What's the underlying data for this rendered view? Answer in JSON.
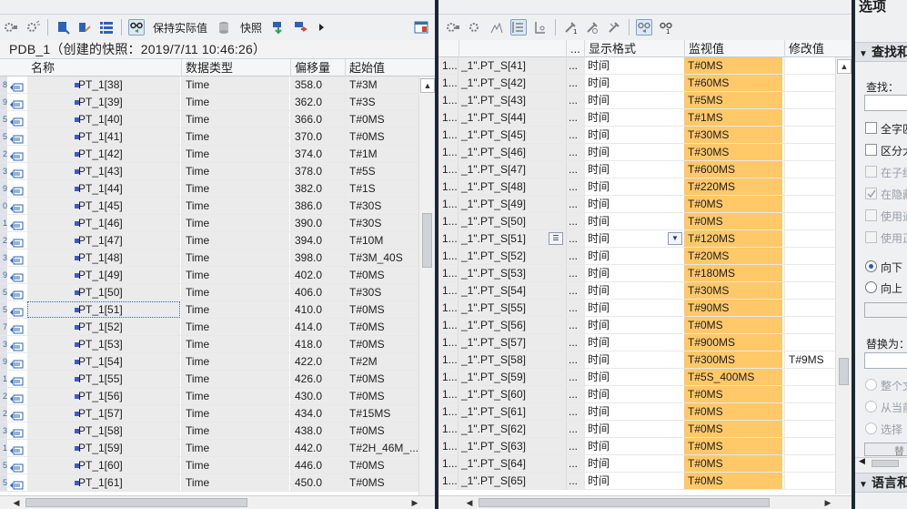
{
  "left_pane": {
    "toolbar": {
      "keep_actual_label": "保持实际值",
      "snapshot_label": "快照"
    },
    "snapshot_title": "PDB_1（创建的快照：2019/7/11 10:46:26）",
    "columns": {
      "name": "名称",
      "datatype": "数据类型",
      "offset": "偏移量",
      "start": "起始值"
    },
    "rows": [
      {
        "num": "8",
        "name": "PT_1[38]",
        "type": "Time",
        "offset": "358.0",
        "start": "T#3M"
      },
      {
        "num": "9",
        "name": "PT_1[39]",
        "type": "Time",
        "offset": "362.0",
        "start": "T#3S"
      },
      {
        "num": "5",
        "name": "PT_1[40]",
        "type": "Time",
        "offset": "366.0",
        "start": "T#0MS"
      },
      {
        "num": "5",
        "name": "PT_1[41]",
        "type": "Time",
        "offset": "370.0",
        "start": "T#0MS"
      },
      {
        "num": "2",
        "name": "PT_1[42]",
        "type": "Time",
        "offset": "374.0",
        "start": "T#1M"
      },
      {
        "num": "3",
        "name": "PT_1[43]",
        "type": "Time",
        "offset": "378.0",
        "start": "T#5S"
      },
      {
        "num": "9",
        "name": "PT_1[44]",
        "type": "Time",
        "offset": "382.0",
        "start": "T#1S"
      },
      {
        "num": "0",
        "name": "PT_1[45]",
        "type": "Time",
        "offset": "386.0",
        "start": "T#30S"
      },
      {
        "num": "1",
        "name": "PT_1[46]",
        "type": "Time",
        "offset": "390.0",
        "start": "T#30S"
      },
      {
        "num": "2",
        "name": "PT_1[47]",
        "type": "Time",
        "offset": "394.0",
        "start": "T#10M"
      },
      {
        "num": "3",
        "name": "PT_1[48]",
        "type": "Time",
        "offset": "398.0",
        "start": "T#3M_40S"
      },
      {
        "num": "9",
        "name": "PT_1[49]",
        "type": "Time",
        "offset": "402.0",
        "start": "T#0MS"
      },
      {
        "num": "5",
        "name": "PT_1[50]",
        "type": "Time",
        "offset": "406.0",
        "start": "T#30S"
      },
      {
        "num": "5",
        "name": "PT_1[51]",
        "type": "Time",
        "offset": "410.0",
        "start": "T#0MS"
      },
      {
        "num": "7",
        "name": "PT_1[52]",
        "type": "Time",
        "offset": "414.0",
        "start": "T#0MS"
      },
      {
        "num": "3",
        "name": "PT_1[53]",
        "type": "Time",
        "offset": "418.0",
        "start": "T#0MS"
      },
      {
        "num": "9",
        "name": "PT_1[54]",
        "type": "Time",
        "offset": "422.0",
        "start": "T#2M"
      },
      {
        "num": "1",
        "name": "PT_1[55]",
        "type": "Time",
        "offset": "426.0",
        "start": "T#0MS"
      },
      {
        "num": "2",
        "name": "PT_1[56]",
        "type": "Time",
        "offset": "430.0",
        "start": "T#0MS"
      },
      {
        "num": "2",
        "name": "PT_1[57]",
        "type": "Time",
        "offset": "434.0",
        "start": "T#15MS"
      },
      {
        "num": "3",
        "name": "PT_1[58]",
        "type": "Time",
        "offset": "438.0",
        "start": "T#0MS"
      },
      {
        "num": "1",
        "name": "PT_1[59]",
        "type": "Time",
        "offset": "442.0",
        "start": "T#2H_46M_..."
      },
      {
        "num": "5",
        "name": "PT_1[60]",
        "type": "Time",
        "offset": "446.0",
        "start": "T#0MS"
      },
      {
        "num": "5",
        "name": "PT_1[61]",
        "type": "Time",
        "offset": "450.0",
        "start": "T#0MS"
      }
    ]
  },
  "mid_pane": {
    "columns": {
      "dots": "...",
      "format": "显示格式",
      "monitor": "监视值",
      "modify": "修改值"
    },
    "rows": [
      {
        "idx": "1...",
        "name": "_1\".PT_S[41]",
        "dots": "...",
        "format": "时间",
        "monitor": "T#0MS",
        "modify": ""
      },
      {
        "idx": "1...",
        "name": "_1\".PT_S[42]",
        "dots": "...",
        "format": "时间",
        "monitor": "T#60MS",
        "modify": ""
      },
      {
        "idx": "1...",
        "name": "_1\".PT_S[43]",
        "dots": "...",
        "format": "时间",
        "monitor": "T#5MS",
        "modify": ""
      },
      {
        "idx": "1...",
        "name": "_1\".PT_S[44]",
        "dots": "...",
        "format": "时间",
        "monitor": "T#1MS",
        "modify": ""
      },
      {
        "idx": "1...",
        "name": "_1\".PT_S[45]",
        "dots": "...",
        "format": "时间",
        "monitor": "T#30MS",
        "modify": ""
      },
      {
        "idx": "1...",
        "name": "_1\".PT_S[46]",
        "dots": "...",
        "format": "时间",
        "monitor": "T#30MS",
        "modify": ""
      },
      {
        "idx": "1...",
        "name": "_1\".PT_S[47]",
        "dots": "...",
        "format": "时间",
        "monitor": "T#600MS",
        "modify": ""
      },
      {
        "idx": "1...",
        "name": "_1\".PT_S[48]",
        "dots": "...",
        "format": "时间",
        "monitor": "T#220MS",
        "modify": ""
      },
      {
        "idx": "1...",
        "name": "_1\".PT_S[49]",
        "dots": "...",
        "format": "时间",
        "monitor": "T#0MS",
        "modify": ""
      },
      {
        "idx": "1...",
        "name": "_1\".PT_S[50]",
        "dots": "...",
        "format": "时间",
        "monitor": "T#0MS",
        "modify": ""
      },
      {
        "idx": "1...",
        "name": "_1\".PT_S[51]",
        "dots": "...",
        "format": "时间",
        "monitor": "T#120MS",
        "modify": ""
      },
      {
        "idx": "1...",
        "name": "_1\".PT_S[52]",
        "dots": "...",
        "format": "时间",
        "monitor": "T#20MS",
        "modify": ""
      },
      {
        "idx": "1...",
        "name": "_1\".PT_S[53]",
        "dots": "...",
        "format": "时间",
        "monitor": "T#180MS",
        "modify": ""
      },
      {
        "idx": "1...",
        "name": "_1\".PT_S[54]",
        "dots": "...",
        "format": "时间",
        "monitor": "T#30MS",
        "modify": ""
      },
      {
        "idx": "1...",
        "name": "_1\".PT_S[55]",
        "dots": "...",
        "format": "时间",
        "monitor": "T#90MS",
        "modify": ""
      },
      {
        "idx": "1...",
        "name": "_1\".PT_S[56]",
        "dots": "...",
        "format": "时间",
        "monitor": "T#0MS",
        "modify": ""
      },
      {
        "idx": "1...",
        "name": "_1\".PT_S[57]",
        "dots": "...",
        "format": "时间",
        "monitor": "T#900MS",
        "modify": ""
      },
      {
        "idx": "1...",
        "name": "_1\".PT_S[58]",
        "dots": "...",
        "format": "时间",
        "monitor": "T#300MS",
        "modify": "T#9MS"
      },
      {
        "idx": "1...",
        "name": "_1\".PT_S[59]",
        "dots": "...",
        "format": "时间",
        "monitor": "T#5S_400MS",
        "modify": ""
      },
      {
        "idx": "1...",
        "name": "_1\".PT_S[60]",
        "dots": "...",
        "format": "时间",
        "monitor": "T#0MS",
        "modify": ""
      },
      {
        "idx": "1...",
        "name": "_1\".PT_S[61]",
        "dots": "...",
        "format": "时间",
        "monitor": "T#0MS",
        "modify": ""
      },
      {
        "idx": "1...",
        "name": "_1\".PT_S[62]",
        "dots": "...",
        "format": "时间",
        "monitor": "T#0MS",
        "modify": ""
      },
      {
        "idx": "1...",
        "name": "_1\".PT_S[63]",
        "dots": "...",
        "format": "时间",
        "monitor": "T#0MS",
        "modify": ""
      },
      {
        "idx": "1...",
        "name": "_1\".PT_S[64]",
        "dots": "...",
        "format": "时间",
        "monitor": "T#0MS",
        "modify": ""
      },
      {
        "idx": "1...",
        "name": "_1\".PT_S[65]",
        "dots": "...",
        "format": "时间",
        "monitor": "T#0MS",
        "modify": ""
      }
    ]
  },
  "right_pane": {
    "title": "选项",
    "find_section": "查找和",
    "find_label": "查找：",
    "chk_whole_word": "全字匹",
    "chk_case": "区分大",
    "chk_sub": "在子结",
    "chk_hidden": "在隐藏",
    "chk_use1": "使用通",
    "chk_use2": "使用正",
    "radio_down": "向下",
    "radio_up": "向上",
    "replace_label": "替换为：",
    "radio_whole_doc": "整个文",
    "radio_from_cur": "从当前",
    "radio_select": "选择",
    "replace_btn": "替",
    "lang_section": "语言和"
  }
}
